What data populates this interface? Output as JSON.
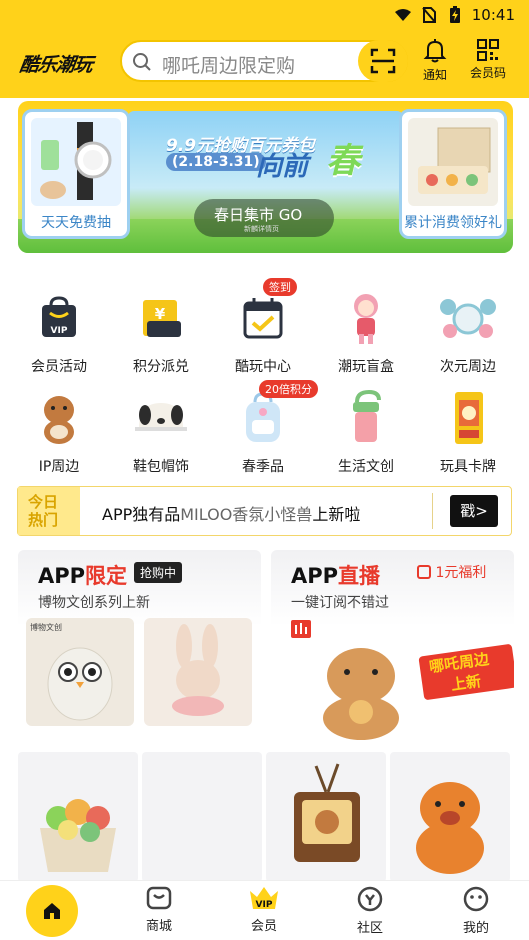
{
  "status_bar": {
    "time": "10:41"
  },
  "header": {
    "logo_text": "酷乐潮玩",
    "search_placeholder": "哪吒周边限定购",
    "notify_label": "通知",
    "member_code_label": "会员码"
  },
  "banner": {
    "left_card_caption": "天天免费抽",
    "right_card_caption": "累计消费领好礼",
    "headline_small": "9.9元抢购百元券包",
    "date_range": "(2.18-3.31)",
    "headline_big": "向前",
    "headline_art": "春",
    "cta": "春日集市 GO",
    "cta_sub": "新麟详情页"
  },
  "categories": [
    {
      "label": "会员活动",
      "icon": "vip-bag-icon"
    },
    {
      "label": "积分派兑",
      "icon": "yen-coupon-icon"
    },
    {
      "label": "酷玩中心",
      "icon": "calendar-check-icon",
      "badge": "签到"
    },
    {
      "label": "潮玩盲盒",
      "icon": "figure-doll-icon"
    },
    {
      "label": "次元周边",
      "icon": "anime-keychain-icon"
    },
    {
      "label": "IP周边",
      "icon": "capybara-plush-icon"
    },
    {
      "label": "鞋包帽饰",
      "icon": "dog-cap-icon"
    },
    {
      "label": "春季品",
      "icon": "backpack-icon",
      "badge": "20倍积分"
    },
    {
      "label": "生活文创",
      "icon": "bottle-icon"
    },
    {
      "label": "玩具卡牌",
      "icon": "card-pack-icon"
    }
  ],
  "today_hot": {
    "tag_line1": "今日",
    "tag_line2": "热门",
    "text_a": "APP独有品",
    "text_b": "MILOO香氛小怪兽",
    "text_c": "上新啦",
    "button": "戳>"
  },
  "promo_left": {
    "title_a": "APP",
    "title_b": "限定",
    "pill": "抢购中",
    "subtitle": "博物文创系列上新",
    "img_label": "博物文创"
  },
  "promo_right": {
    "title_a": "APP",
    "title_b": "直播",
    "pill": "1元福利",
    "subtitle": "一键订阅不错过",
    "sticker_line1": "哪吒周边",
    "sticker_line2": "上新"
  },
  "nav": [
    {
      "label": "",
      "icon": "home-icon"
    },
    {
      "label": "商城",
      "icon": "shop-bag-icon"
    },
    {
      "label": "会员",
      "icon": "vip-crown-icon"
    },
    {
      "label": "社区",
      "icon": "community-icon"
    },
    {
      "label": "我的",
      "icon": "profile-icon"
    }
  ],
  "colors": {
    "brand_yellow": "#ffd21a",
    "accent_red": "#e83a2c",
    "banner_blue": "#3b86c7"
  }
}
